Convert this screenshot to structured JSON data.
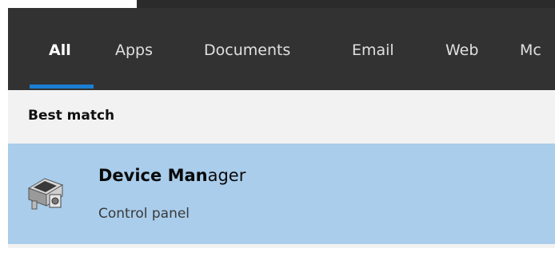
{
  "tabs": [
    {
      "label": "All",
      "active": true
    },
    {
      "label": "Apps",
      "active": false
    },
    {
      "label": "Documents",
      "active": false
    },
    {
      "label": "Email",
      "active": false
    },
    {
      "label": "Web",
      "active": false
    },
    {
      "label": "Mc",
      "active": false
    }
  ],
  "section": {
    "best_match": "Best match"
  },
  "result": {
    "title_bold_1": "Device Man",
    "title_rest": "ager",
    "subtitle": "Control panel",
    "icon": "device-manager-icon"
  },
  "colors": {
    "tabbar_bg": "#323232",
    "accent": "#1a7fd4",
    "selected_bg": "#a9cdeb",
    "panel_bg": "#f2f2f2"
  }
}
